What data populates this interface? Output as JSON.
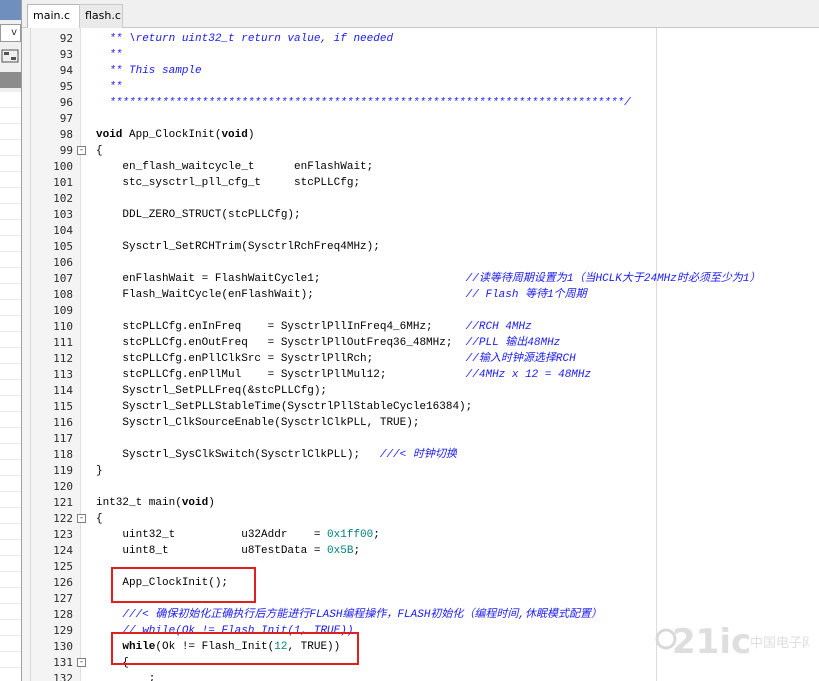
{
  "tabs": [
    {
      "label": "main.c *",
      "active": true
    },
    {
      "label": "flash.c",
      "active": false
    }
  ],
  "left_panel": {
    "dropdown_arrow": "v"
  },
  "lines": [
    {
      "n": "92",
      "fold": "",
      "parts": [
        {
          "t": "  ** \\return uint32_t return value, if needed",
          "c": "cm"
        }
      ]
    },
    {
      "n": "93",
      "fold": "",
      "parts": [
        {
          "t": "  **",
          "c": "cm"
        }
      ]
    },
    {
      "n": "94",
      "fold": "",
      "parts": [
        {
          "t": "  ** This sample",
          "c": "cm"
        }
      ]
    },
    {
      "n": "95",
      "fold": "",
      "parts": [
        {
          "t": "  **",
          "c": "cm"
        }
      ]
    },
    {
      "n": "96",
      "fold": "",
      "parts": [
        {
          "t": "  ******************************************************************************/",
          "c": "cm"
        }
      ]
    },
    {
      "n": "97",
      "fold": "",
      "parts": []
    },
    {
      "n": "98",
      "fold": "",
      "parts": [
        {
          "t": "void",
          "c": "kw"
        },
        {
          "t": " App_ClockInit(",
          "c": ""
        },
        {
          "t": "void",
          "c": "kw"
        },
        {
          "t": ")",
          "c": ""
        }
      ]
    },
    {
      "n": "99",
      "fold": "-",
      "parts": [
        {
          "t": "{",
          "c": ""
        }
      ]
    },
    {
      "n": "100",
      "fold": "",
      "parts": [
        {
          "t": "    en_flash_waitcycle_t      enFlashWait;",
          "c": ""
        }
      ]
    },
    {
      "n": "101",
      "fold": "",
      "parts": [
        {
          "t": "    stc_sysctrl_pll_cfg_t     stcPLLCfg;",
          "c": ""
        }
      ]
    },
    {
      "n": "102",
      "fold": "",
      "parts": []
    },
    {
      "n": "103",
      "fold": "",
      "parts": [
        {
          "t": "    DDL_ZERO_STRUCT(stcPLLCfg);",
          "c": ""
        }
      ]
    },
    {
      "n": "104",
      "fold": "",
      "parts": []
    },
    {
      "n": "105",
      "fold": "",
      "parts": [
        {
          "t": "    Sysctrl_SetRCHTrim(SysctrlRchFreq4MHz);",
          "c": ""
        }
      ]
    },
    {
      "n": "106",
      "fold": "",
      "parts": []
    },
    {
      "n": "107",
      "fold": "",
      "parts": [
        {
          "t": "    enFlashWait = FlashWaitCycle1;                      ",
          "c": ""
        },
        {
          "t": "//读等待周期设置为1（当HCLK大于24MHz时必须至少为1）",
          "c": "cm"
        }
      ]
    },
    {
      "n": "108",
      "fold": "",
      "parts": [
        {
          "t": "    Flash_WaitCycle(enFlashWait);                       ",
          "c": ""
        },
        {
          "t": "// Flash 等待1个周期",
          "c": "cm"
        }
      ]
    },
    {
      "n": "109",
      "fold": "",
      "parts": []
    },
    {
      "n": "110",
      "fold": "",
      "parts": [
        {
          "t": "    stcPLLCfg.enInFreq    = SysctrlPllInFreq4_6MHz;     ",
          "c": ""
        },
        {
          "t": "//RCH 4MHz",
          "c": "cm"
        }
      ]
    },
    {
      "n": "111",
      "fold": "",
      "parts": [
        {
          "t": "    stcPLLCfg.enOutFreq   = SysctrlPllOutFreq36_48MHz;  ",
          "c": ""
        },
        {
          "t": "//PLL 输出48MHz",
          "c": "cm"
        }
      ]
    },
    {
      "n": "112",
      "fold": "",
      "parts": [
        {
          "t": "    stcPLLCfg.enPllClkSrc = SysctrlPllRch;              ",
          "c": ""
        },
        {
          "t": "//输入时钟源选择RCH",
          "c": "cm"
        }
      ]
    },
    {
      "n": "113",
      "fold": "",
      "parts": [
        {
          "t": "    stcPLLCfg.enPllMul    = SysctrlPllMul12;            ",
          "c": ""
        },
        {
          "t": "//4MHz x 12 = 48MHz",
          "c": "cm"
        }
      ]
    },
    {
      "n": "114",
      "fold": "",
      "parts": [
        {
          "t": "    Sysctrl_SetPLLFreq(&stcPLLCfg);",
          "c": ""
        }
      ]
    },
    {
      "n": "115",
      "fold": "",
      "parts": [
        {
          "t": "    Sysctrl_SetPLLStableTime(SysctrlPllStableCycle16384);",
          "c": ""
        }
      ]
    },
    {
      "n": "116",
      "fold": "",
      "parts": [
        {
          "t": "    Sysctrl_ClkSourceEnable(SysctrlClkPLL, TRUE);",
          "c": ""
        }
      ]
    },
    {
      "n": "117",
      "fold": "",
      "parts": []
    },
    {
      "n": "118",
      "fold": "",
      "parts": [
        {
          "t": "    Sysctrl_SysClkSwitch(SysctrlClkPLL);   ",
          "c": ""
        },
        {
          "t": "///< 时钟切换",
          "c": "cm"
        }
      ]
    },
    {
      "n": "119",
      "fold": "",
      "parts": [
        {
          "t": "}",
          "c": ""
        }
      ]
    },
    {
      "n": "120",
      "fold": "",
      "parts": []
    },
    {
      "n": "121",
      "fold": "",
      "parts": [
        {
          "t": "int32_t main(",
          "c": ""
        },
        {
          "t": "void",
          "c": "kw"
        },
        {
          "t": ")",
          "c": ""
        }
      ]
    },
    {
      "n": "122",
      "fold": "-",
      "parts": [
        {
          "t": "{",
          "c": ""
        }
      ]
    },
    {
      "n": "123",
      "fold": "",
      "parts": [
        {
          "t": "    uint32_t          u32Addr    = ",
          "c": ""
        },
        {
          "t": "0x1ff00",
          "c": "num"
        },
        {
          "t": ";",
          "c": ""
        }
      ]
    },
    {
      "n": "124",
      "fold": "",
      "parts": [
        {
          "t": "    uint8_t           u8TestData = ",
          "c": ""
        },
        {
          "t": "0x5B",
          "c": "num"
        },
        {
          "t": ";",
          "c": ""
        }
      ]
    },
    {
      "n": "125",
      "fold": "",
      "parts": []
    },
    {
      "n": "126",
      "fold": "",
      "parts": [
        {
          "t": "    App_ClockInit();",
          "c": ""
        }
      ]
    },
    {
      "n": "127",
      "fold": "",
      "parts": []
    },
    {
      "n": "128",
      "fold": "",
      "parts": [
        {
          "t": "    ",
          "c": ""
        },
        {
          "t": "///< 确保初始化正确执行后方能进行FLASH编程操作，FLASH初始化（编程时间,休眠模式配置）",
          "c": "cm"
        }
      ]
    },
    {
      "n": "129",
      "fold": "",
      "parts": [
        {
          "t": "    ",
          "c": ""
        },
        {
          "t": "// while(Ok != Flash_Init(1, TRUE))",
          "c": "cm"
        }
      ]
    },
    {
      "n": "130",
      "fold": "",
      "parts": [
        {
          "t": "    ",
          "c": ""
        },
        {
          "t": "while",
          "c": "kw"
        },
        {
          "t": "(Ok != Flash_Init(",
          "c": ""
        },
        {
          "t": "12",
          "c": "num"
        },
        {
          "t": ", TRUE))",
          "c": ""
        }
      ]
    },
    {
      "n": "131",
      "fold": "-",
      "parts": [
        {
          "t": "    {",
          "c": ""
        }
      ]
    },
    {
      "n": "132",
      "fold": "",
      "parts": [
        {
          "t": "        ;",
          "c": ""
        }
      ]
    }
  ],
  "watermark": {
    "main": "21ic",
    "cn": "中国电子网"
  }
}
